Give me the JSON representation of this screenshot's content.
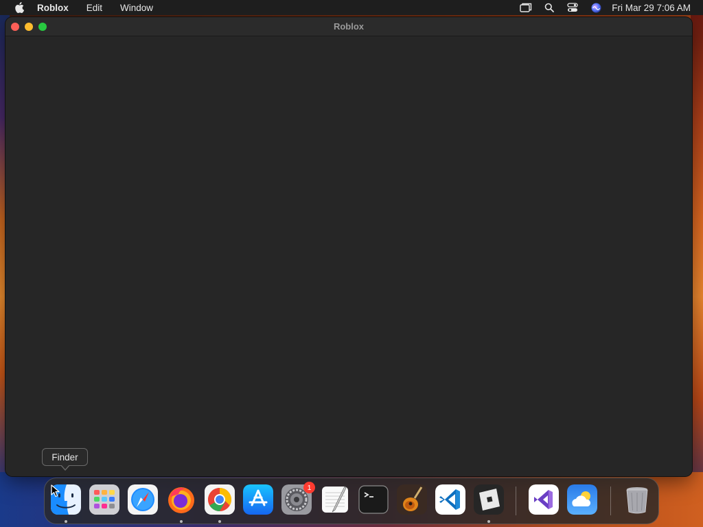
{
  "menubar": {
    "app_name": "Roblox",
    "items": [
      "Edit",
      "Window"
    ],
    "clock": "Fri Mar 29  7:06 AM",
    "status_icons": [
      "screen-mirroring-icon",
      "spotlight-search-icon",
      "control-center-icon",
      "siri-icon"
    ]
  },
  "window": {
    "title": "Roblox"
  },
  "tooltip": {
    "label": "Finder"
  },
  "dock": {
    "apps": [
      {
        "name": "finder-icon",
        "running": true
      },
      {
        "name": "launchpad-icon",
        "running": false
      },
      {
        "name": "safari-icon",
        "running": false
      },
      {
        "name": "firefox-icon",
        "running": true
      },
      {
        "name": "chrome-icon",
        "running": true
      },
      {
        "name": "app-store-icon",
        "running": false
      },
      {
        "name": "system-settings-icon",
        "running": false,
        "badge": "1"
      },
      {
        "name": "textedit-icon",
        "running": false
      },
      {
        "name": "terminal-icon",
        "running": false
      },
      {
        "name": "garageband-icon",
        "running": false
      },
      {
        "name": "vscode-icon",
        "running": false
      },
      {
        "name": "roblox-icon",
        "running": true
      },
      {
        "name": "visual-studio-icon",
        "running": false
      },
      {
        "name": "weather-icon",
        "running": false
      },
      {
        "name": "trash-icon",
        "running": false
      }
    ],
    "settings_badge": "1",
    "colors": {
      "close": "#fe5f57",
      "minimize": "#febc2e",
      "maximize": "#28c840",
      "badge": "#ff3b30"
    }
  }
}
